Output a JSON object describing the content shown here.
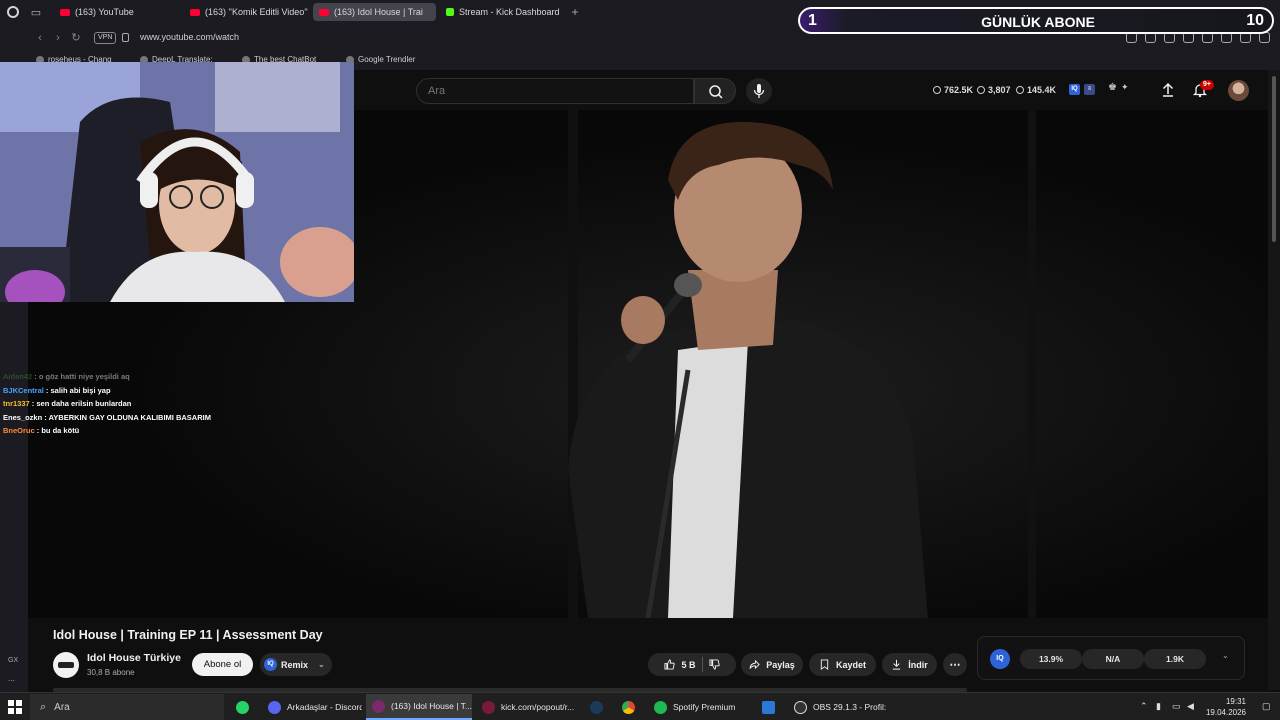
{
  "browser": {
    "tabs": [
      {
        "label": "(163) YouTube",
        "active": false
      },
      {
        "label": "(163) ''Komik Editli Video''",
        "active": false
      },
      {
        "label": "(163) Idol House | Trai",
        "active": true
      },
      {
        "label": "Stream - Kick Dashboard",
        "active": false
      }
    ],
    "vpn_label": "VPN",
    "url": "www.youtube.com/watch",
    "bookmarks": [
      "roseheus - Chang",
      "DeepL Translate:",
      "The best ChatBot",
      "Google Trendler"
    ]
  },
  "overlay": {
    "daily_subs_title": "GÜNLÜK ABONE",
    "daily_subs_current": "1",
    "daily_subs_goal": "10"
  },
  "youtube": {
    "search_placeholder": "Ara",
    "stats": {
      "likes": "762.5K",
      "views": "3,807",
      "watching": "145.4K"
    },
    "notification_badge": "9+"
  },
  "chat": [
    {
      "user": "Aiden42",
      "color": "#3a8a3a",
      "text": " : o göz hatti niye yeşildi aq",
      "faded": true
    },
    {
      "user": "BJKCentral",
      "color": "#4aa3ff",
      "text": " : salih abi bişi yap"
    },
    {
      "user": "tnr1337",
      "color": "#f0c030",
      "text": " : sen daha erilsin bunlardan"
    },
    {
      "user": "Enes_ozkn",
      "color": "#ffffff",
      "text": " : AYBERKIN GAY OLDUNA KALIBIMI BASARIM"
    },
    {
      "user": "BneOruc",
      "color": "#ff8a3a",
      "text": " : bu da kötü"
    }
  ],
  "video": {
    "title": "Idol House | Training EP 11 | Assessment Day",
    "channel": "Idol House Türkiye",
    "subscribers": "30,8 B abone",
    "subscribe_label": "Abone ol",
    "remix_label": "Remix",
    "like_count": "5 B",
    "share_label": "Paylaş",
    "save_label": "Kaydet",
    "download_label": "İndir"
  },
  "iq_stats": {
    "logo": "IQ",
    "values": [
      "13.9%",
      "N/A",
      "1.9K"
    ]
  },
  "sidebar": {
    "labels": [
      "GX"
    ]
  },
  "taskbar": {
    "search_placeholder": "Ara",
    "apps": [
      {
        "label": "Arkadaşlar - Discord",
        "color": "#5865f2"
      },
      {
        "label": "(163) Idol House | T...",
        "color": "#7a2a6a",
        "active": true
      },
      {
        "label": "kick.com/popout/r...",
        "color": "#7a1a3a"
      },
      {
        "label": "Spotify Premium",
        "color": "#1db954"
      },
      {
        "label": "OBS 29.1.3 - Profil: ...",
        "color": "#333"
      }
    ],
    "time": "19:31",
    "date": "19.04.2026"
  }
}
